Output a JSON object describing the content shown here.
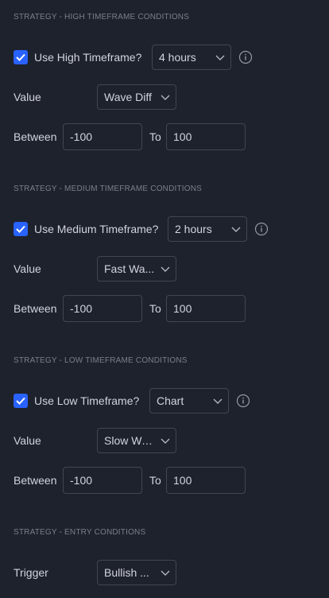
{
  "sections": [
    {
      "title": "STRATEGY - HIGH TIMEFRAME CONDITIONS",
      "checkbox_label": "Use High Timeframe?",
      "checked": true,
      "timeframe": "4 hours",
      "value_label": "Value",
      "value_selected": "Wave Diff",
      "between_label": "Between",
      "from": "-100",
      "to_label": "To",
      "to": "100"
    },
    {
      "title": "STRATEGY - MEDIUM TIMEFRAME CONDITIONS",
      "checkbox_label": "Use Medium Timeframe?",
      "checked": true,
      "timeframe": "2 hours",
      "value_label": "Value",
      "value_selected": "Fast Wa...",
      "between_label": "Between",
      "from": "-100",
      "to_label": "To",
      "to": "100"
    },
    {
      "title": "STRATEGY - LOW TIMEFRAME CONDITIONS",
      "checkbox_label": "Use Low Timeframe?",
      "checked": true,
      "timeframe": "Chart",
      "value_label": "Value",
      "value_selected": "Slow Wa...",
      "between_label": "Between",
      "from": "-100",
      "to_label": "To",
      "to": "100"
    }
  ],
  "entry": {
    "title": "STRATEGY - ENTRY CONDITIONS",
    "trigger_label": "Trigger",
    "trigger_selected": "Bullish ..."
  },
  "colors": {
    "background": "#1e222d",
    "accent": "#2962ff",
    "border": "#434651",
    "text": "#d1d4dc",
    "muted": "#7b7f8b"
  },
  "icons": {
    "checkbox": "checkmark-icon",
    "dropdown": "chevron-down-icon",
    "info": "info-icon"
  }
}
